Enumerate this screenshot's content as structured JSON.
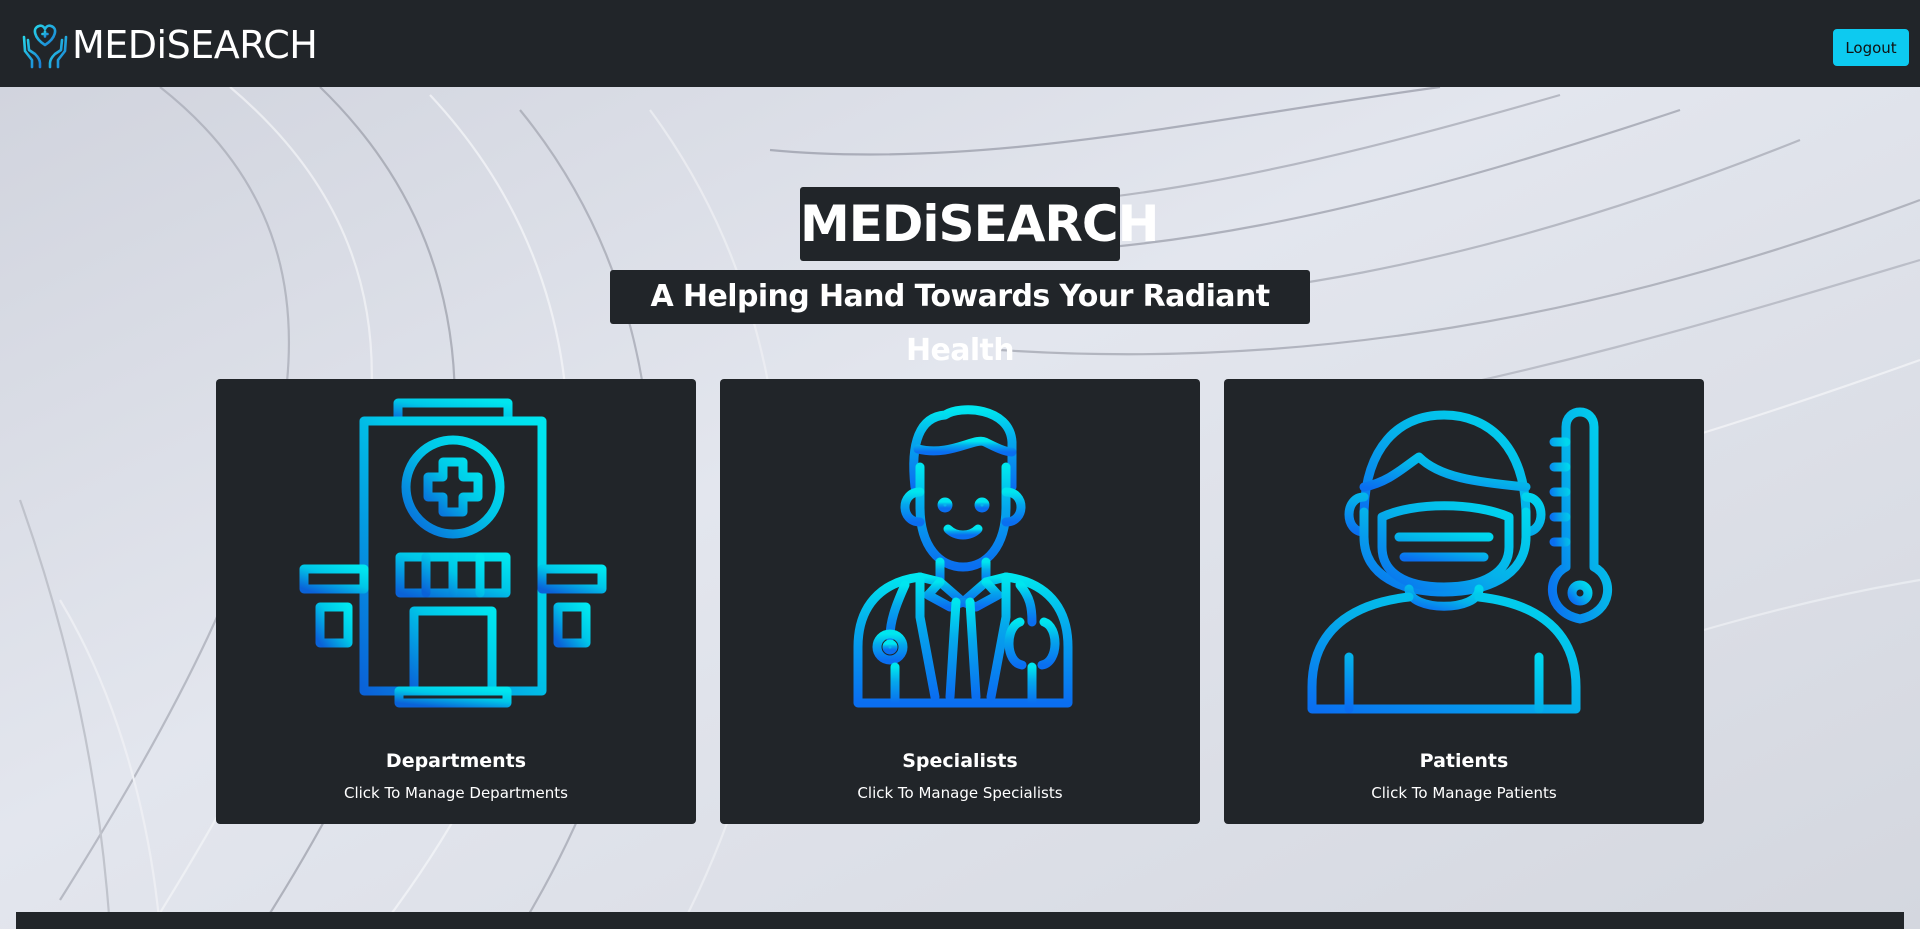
{
  "navbar": {
    "brand_text": "MEDiSEARCH",
    "logo_icon": "hands-heart-cross-icon",
    "logout_label": "Logout"
  },
  "hero": {
    "title": "MEDiSEARCH",
    "subtitle": "A Helping Hand Towards Your Radiant Health"
  },
  "cards": [
    {
      "icon": "hospital-building-icon",
      "title": "Departments",
      "text": "Click To Manage Departments"
    },
    {
      "icon": "doctor-specialist-icon",
      "title": "Specialists",
      "text": "Click To Manage Specialists"
    },
    {
      "icon": "masked-patient-thermometer-icon",
      "title": "Patients",
      "text": "Click To Manage Patients"
    }
  ],
  "colors": {
    "navbar_bg": "#212529",
    "card_bg": "#212529",
    "button_accent": "#0dcaf0",
    "icon_gradient_cyan": "#00e1ee",
    "icon_gradient_blue": "#0a6ef0"
  }
}
